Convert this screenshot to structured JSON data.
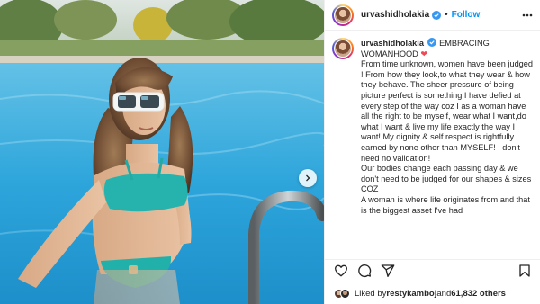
{
  "post": {
    "author": {
      "username": "urvashidholakia",
      "verified": true,
      "avatar_icon": "profile-avatar"
    },
    "header": {
      "separator": "•",
      "follow_label": "Follow",
      "more_icon": "more-horizontal-icon"
    },
    "caption": {
      "username": "urvashidholakia",
      "text_start": "EMBRACING WOMANHOOD ",
      "emoji": "❤",
      "body": "From time unknown, women have been judged ! From how they look,to what they wear & how they behave. The sheer pressure of being picture perfect is something I have defied at every step of the way coz I as a woman have all the right to be myself, wear what I want,do what I want & live my life exactly the way I want! My dignity & self respect is rightfully earned by none other than MYSELF! I don't need no validation!\nOur bodies change each passing day & we don't need to be judged for our shapes & sizes COZ\nA woman is where life originates from and that is the biggest asset I've had"
    },
    "actions": {
      "like_icon": "heart-icon",
      "comment_icon": "comment-icon",
      "share_icon": "send-icon",
      "save_icon": "bookmark-icon"
    },
    "likes": {
      "prefix": "Liked by ",
      "liker": "restykamboj",
      "conjunction": " and ",
      "count_text": "61,832 others"
    },
    "media": {
      "type": "photo",
      "carousel_next_icon": "chevron-right-icon"
    },
    "colors": {
      "link_blue": "#0095f6",
      "verified_blue": "#3897f0",
      "heart_red": "#ed4956",
      "text": "#262626",
      "pool_water": "#2f9fd6"
    }
  }
}
